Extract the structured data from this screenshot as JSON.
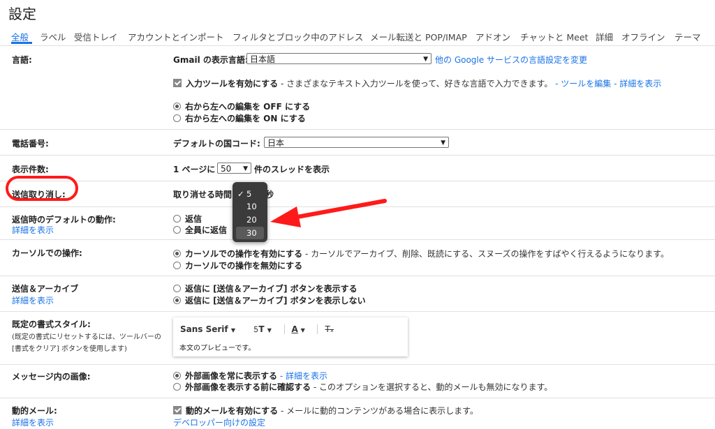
{
  "page": {
    "title": "設定"
  },
  "tabs": [
    {
      "label": "全般"
    },
    {
      "label": "ラベル"
    },
    {
      "label": "受信トレイ"
    },
    {
      "label": "アカウントとインポート"
    },
    {
      "label": "フィルタとブロック中のアドレス"
    },
    {
      "label": "メール転送と POP/IMAP"
    },
    {
      "label": "アドオン"
    },
    {
      "label": "チャットと Meet"
    },
    {
      "label": "詳細"
    },
    {
      "label": "オフライン"
    },
    {
      "label": "テーマ"
    }
  ],
  "language": {
    "label": "言語:",
    "display_label": "Gmail の表示言語:",
    "selected": "日本語",
    "google_link": "他の Google サービスの言語設定を変更",
    "input_tools_label": "入力ツールを有効にする",
    "input_tools_desc": " - さまざまなテキスト入力ツールを使って、好きな言語で入力できます。",
    "edit_tools_link": "- ツールを編集",
    "details_link": "- 詳細を表示",
    "rtl_off": "右から左への編集を OFF にする",
    "rtl_on": "右から左への編集を ON にする"
  },
  "phone": {
    "label": "電話番号:",
    "country_label": "デフォルトの国コード:",
    "selected": "日本"
  },
  "page_size": {
    "label": "表示件数:",
    "prefix": "1 ページに",
    "selected": "50",
    "suffix": "件のスレッドを表示"
  },
  "undo_send": {
    "label": "送信取り消し:",
    "text": "取り消せる時間",
    "suffix": "秒",
    "options": [
      "5",
      "10",
      "20",
      "30"
    ],
    "checked_index": 0,
    "highlighted_index": 3
  },
  "reply_default": {
    "label": "返信時のデフォルトの動作:",
    "details_link": "詳細を表示",
    "reply": "返信",
    "reply_all": "全員に返信"
  },
  "hover_actions": {
    "label": "カーソルでの操作:",
    "enable": "カーソルでの操作を有効にする",
    "enable_desc": " - カーソルでアーカイブ、削除、既読にする、スヌーズの操作をすばやく行えるようになります。",
    "disable": "カーソルでの操作を無効にする"
  },
  "send_archive": {
    "label": "送信＆アーカイブ",
    "details_link": "詳細を表示",
    "show": "返信に [送信＆アーカイブ] ボタンを表示する",
    "hide": "返信に [送信＆アーカイブ] ボタンを表示しない"
  },
  "text_style": {
    "label": "既定の書式スタイル:",
    "note_line1": "(既定の書式にリセットするには、ツールバーの",
    "note_line2": "[書式をクリア] ボタンを使用します)",
    "font": "Sans Serif",
    "preview": "本文のプレビューです。"
  },
  "images": {
    "label": "メッセージ内の画像:",
    "always": "外部画像を常に表示する",
    "details_link": "- 詳細を表示",
    "ask": "外部画像を表示する前に確認する",
    "ask_desc": " - このオプションを選択すると、動的メールも無効になります。"
  },
  "dynamic": {
    "label": "動的メール:",
    "details_link": "詳細を表示",
    "enable": "動的メールを有効にする",
    "enable_desc": " - メールに動的コンテンツがある場合に表示します。",
    "dev_link": "デベロッパー向けの設定"
  },
  "colors": {
    "accent": "#1a73e8",
    "annotation": "#ff1a1a"
  }
}
